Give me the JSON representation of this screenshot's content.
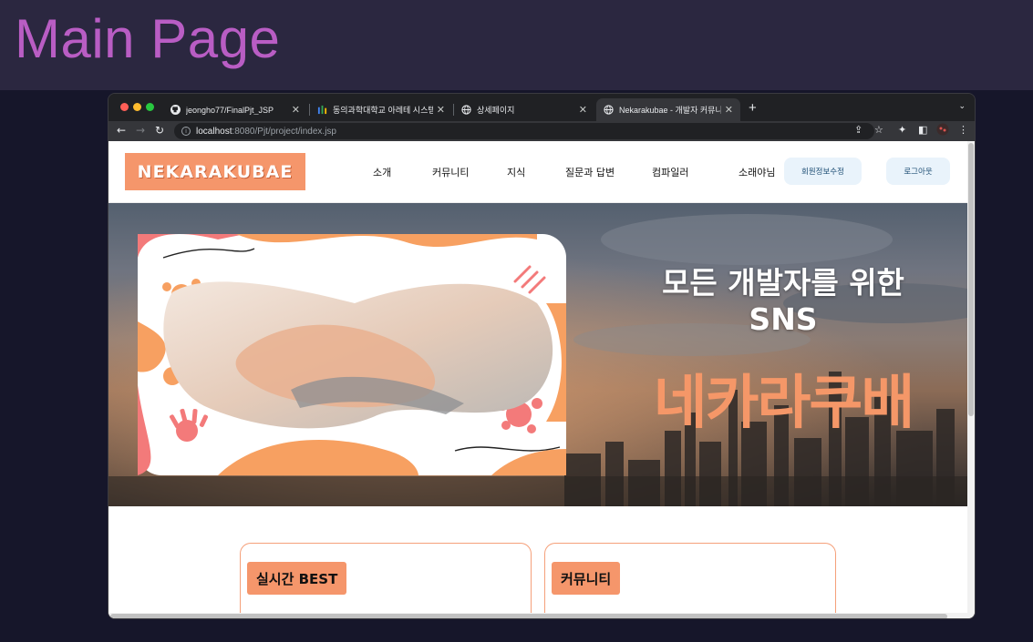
{
  "slide": {
    "title": "Main Page"
  },
  "browser": {
    "tabs": [
      {
        "title": "jeongho77/FinalPjt_JSP",
        "icon": "github-icon"
      },
      {
        "title": "동의과학대학교 아레테 시스템",
        "icon": "university-icon"
      },
      {
        "title": "상세페이지",
        "icon": "globe-icon"
      },
      {
        "title": "Nekarakubae - 개발자 커뮤니티",
        "icon": "globe-icon",
        "active": true
      }
    ],
    "new_tab": "+",
    "url_host": "localhost",
    "url_path": ":8080/Pjt/project/index.jsp"
  },
  "site": {
    "logo_text": "NEKARAKUBAE",
    "nav": [
      "소개",
      "커뮤니티",
      "지식",
      "질문과 답변",
      "컴파일러"
    ],
    "user_name": "소래야님",
    "edit_profile": "회원정보수정",
    "logout": "로그아웃"
  },
  "hero": {
    "headline_line1": "모든 개발자를 위한",
    "headline_line2": "SNS",
    "brand": "네카라쿠배"
  },
  "sections": [
    {
      "label": "실시간 BEST"
    },
    {
      "label": "커뮤니티"
    }
  ],
  "colors": {
    "accent": "#f5966b",
    "slide_title": "#b95dc4",
    "pill_bg": "#e9f3fb"
  }
}
